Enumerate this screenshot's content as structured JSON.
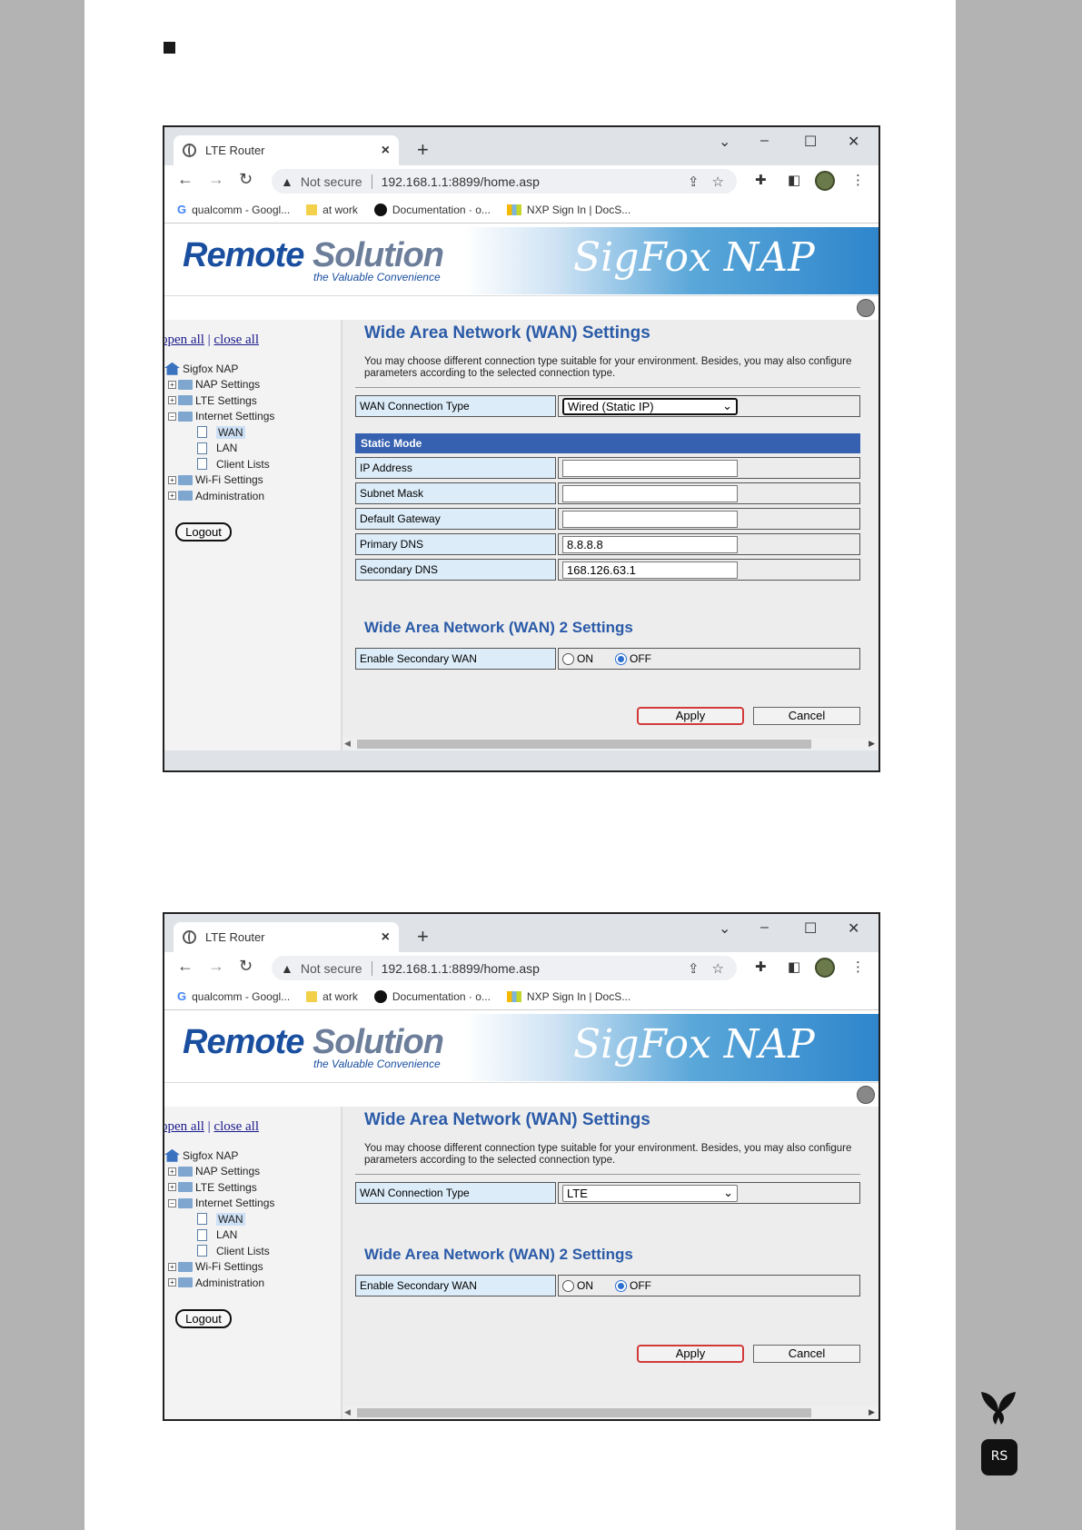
{
  "browser": {
    "tab_title": "LTE Router",
    "tab_close": "×",
    "new_tab": "+",
    "win_min": "–",
    "win_max": "☐",
    "win_close": "✕",
    "win_menu": "⌄",
    "not_secure": "Not secure",
    "url": "192.168.1.1:8899/home.asp",
    "bookmarks": [
      "qualcomm - Googl...",
      "at work",
      "Documentation · o...",
      "NXP Sign In | DocS..."
    ]
  },
  "site": {
    "logo_remote": "Remote",
    "logo_solution": "Solution",
    "tagline": "the Valuable Convenience",
    "product": "SigFox NAP"
  },
  "sidebar": {
    "open_all": "open all",
    "separator": "|",
    "close_all": "close all",
    "root": "Sigfox NAP",
    "items": [
      "NAP Settings",
      "LTE Settings",
      "Internet Settings",
      "WAN",
      "LAN",
      "Client Lists",
      "Wi-Fi Settings",
      "Administration"
    ],
    "logout": "Logout"
  },
  "wan": {
    "title": "Wide Area Network (WAN) Settings",
    "description": "You may choose different connection type suitable for your environment. Besides, you may also configure parameters according to the selected connection type.",
    "connection_type_label": "WAN Connection Type",
    "connection_type_value_1": "Wired (Static IP)",
    "connection_type_value_2": "LTE",
    "static_mode": "Static Mode",
    "ip_address_label": "IP Address",
    "subnet_mask_label": "Subnet Mask",
    "default_gateway_label": "Default Gateway",
    "primary_dns_label": "Primary DNS",
    "primary_dns_value": "8.8.8.8",
    "secondary_dns_label": "Secondary DNS",
    "secondary_dns_value": "168.126.63.1",
    "wan2_title": "Wide Area Network (WAN) 2 Settings",
    "enable_secondary_label": "Enable Secondary WAN",
    "on": "ON",
    "off": "OFF",
    "apply": "Apply",
    "cancel": "Cancel"
  }
}
